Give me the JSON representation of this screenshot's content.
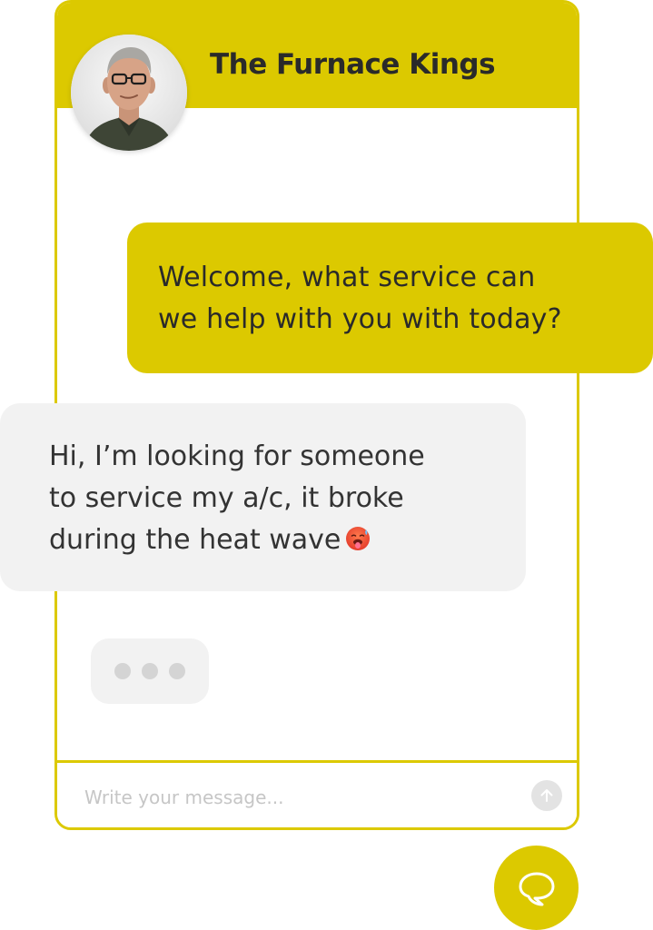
{
  "header": {
    "title": "The Furnace Kings"
  },
  "messages": {
    "agent": {
      "lines": [
        "Welcome, what service can",
        "we help with you with today?"
      ]
    },
    "user": {
      "lines": [
        "Hi, I’m looking for someone",
        "to service my a/c, it broke",
        "during the heat wave"
      ],
      "emoji": "hot-face-emoji"
    }
  },
  "typing_indicator": {
    "dots": 3
  },
  "composer": {
    "placeholder": "Write your message...",
    "send_icon": "arrow-up-icon"
  },
  "launcher": {
    "icon": "speech-bubble-icon"
  },
  "avatar": {
    "icon": "agent-avatar"
  },
  "colors": {
    "brand": "#dcc900",
    "bubble_user": "#f2f2f2",
    "text": "#2a2a2a",
    "placeholder": "#c6c6c6"
  }
}
